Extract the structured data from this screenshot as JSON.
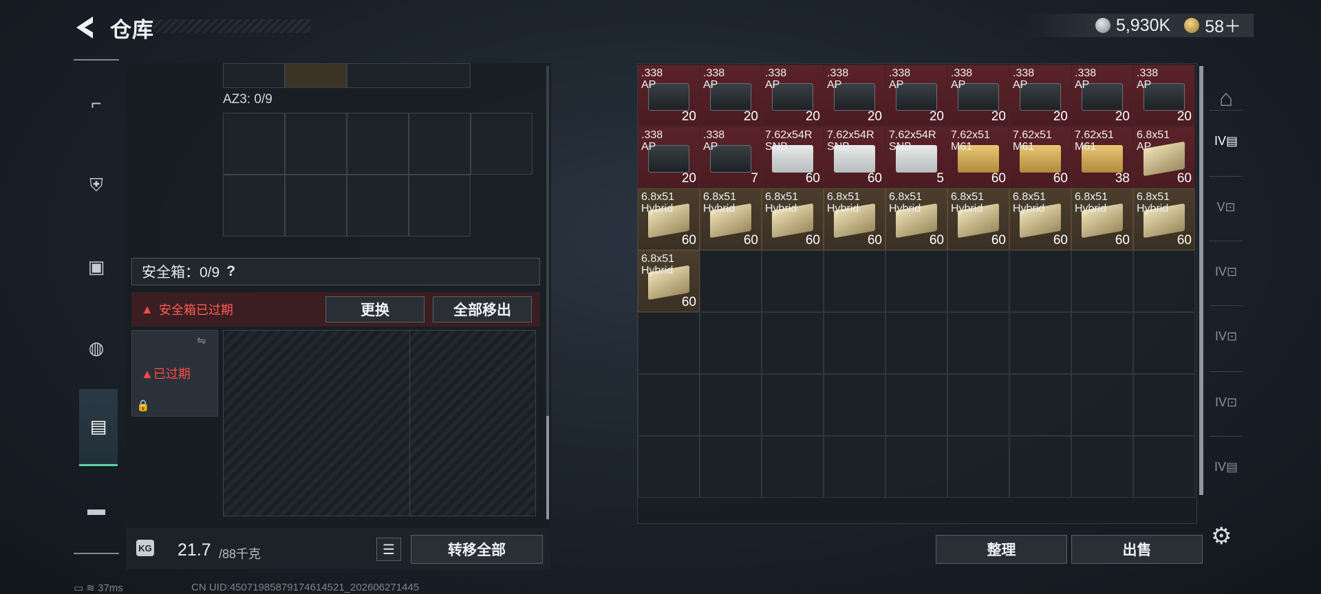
{
  "header": {
    "title": "仓库",
    "silver": "5,930K",
    "gold": "58＋"
  },
  "nav": {
    "items": [
      {
        "icon": "gun-icon",
        "glyph": "⌐"
      },
      {
        "icon": "vest-icon",
        "glyph": "⛨"
      },
      {
        "icon": "armor-icon",
        "glyph": "▣"
      },
      {
        "icon": "backpack-icon",
        "glyph": "◍"
      },
      {
        "icon": "safe-box-icon",
        "glyph": "▤"
      },
      {
        "icon": "briefcase-icon",
        "glyph": "▬"
      }
    ]
  },
  "left": {
    "az_label": "AZ3: 0/9",
    "safe_title": "安全箱：0/9",
    "help_mark": "?",
    "expired_text": "安全箱已过期",
    "replace_button": "更换",
    "remove_all_button": "全部移出",
    "item_expired": "已过期",
    "weight_current": "21.7",
    "weight_max": "/88千克",
    "kg_label": "KG",
    "transfer_all_button": "转移全部"
  },
  "storage": {
    "sort_button": "整理",
    "sell_button": "出售",
    "items": [
      {
        "name": ".338\nAP",
        "count": "20",
        "style": "red",
        "box": "black"
      },
      {
        "name": ".338\nAP",
        "count": "20",
        "style": "red",
        "box": "black"
      },
      {
        "name": ".338\nAP",
        "count": "20",
        "style": "red",
        "box": "black"
      },
      {
        "name": ".338\nAP",
        "count": "20",
        "style": "red",
        "box": "black"
      },
      {
        "name": ".338\nAP",
        "count": "20",
        "style": "red",
        "box": "black"
      },
      {
        "name": ".338\nAP",
        "count": "20",
        "style": "red",
        "box": "black"
      },
      {
        "name": ".338\nAP",
        "count": "20",
        "style": "red",
        "box": "black"
      },
      {
        "name": ".338\nAP",
        "count": "20",
        "style": "red",
        "box": "black"
      },
      {
        "name": ".338\nAP",
        "count": "20",
        "style": "red",
        "box": "black"
      },
      {
        "name": ".338\nAP",
        "count": "20",
        "style": "red",
        "box": "black"
      },
      {
        "name": ".338\nAP",
        "count": "7",
        "style": "red",
        "box": "black"
      },
      {
        "name": "7.62x54R\nSNB",
        "count": "60",
        "style": "red",
        "box": "white"
      },
      {
        "name": "7.62x54R\nSNB",
        "count": "60",
        "style": "red",
        "box": "white"
      },
      {
        "name": "7.62x54R\nSNB",
        "count": "5",
        "style": "red",
        "box": "white"
      },
      {
        "name": "7.62x51\nM61",
        "count": "60",
        "style": "red",
        "box": "gold"
      },
      {
        "name": "7.62x51\nM61",
        "count": "60",
        "style": "red",
        "box": "gold"
      },
      {
        "name": "7.62x51\nM61",
        "count": "38",
        "style": "red",
        "box": "gold"
      },
      {
        "name": "6.8x51\nAP",
        "count": "60",
        "style": "red",
        "box": "tan"
      },
      {
        "name": "6.8x51\nHybrid",
        "count": "60",
        "style": "tan",
        "box": "tan"
      },
      {
        "name": "6.8x51\nHybrid",
        "count": "60",
        "style": "tan",
        "box": "tan"
      },
      {
        "name": "6.8x51\nHybrid",
        "count": "60",
        "style": "tan",
        "box": "tan"
      },
      {
        "name": "6.8x51\nHybrid",
        "count": "60",
        "style": "tan",
        "box": "tan"
      },
      {
        "name": "6.8x51\nHybrid",
        "count": "60",
        "style": "tan",
        "box": "tan"
      },
      {
        "name": "6.8x51\nHybrid",
        "count": "60",
        "style": "tan",
        "box": "tan"
      },
      {
        "name": "6.8x51\nHybrid",
        "count": "60",
        "style": "tan",
        "box": "tan"
      },
      {
        "name": "6.8x51\nHybrid",
        "count": "60",
        "style": "tan",
        "box": "tan"
      },
      {
        "name": "6.8x51\nHybrid",
        "count": "60",
        "style": "tan",
        "box": "tan"
      },
      {
        "name": "6.8x51\nHybrid",
        "count": "60",
        "style": "tan",
        "box": "tan"
      }
    ]
  },
  "side_tabs": [
    {
      "icon": "home-shelf-icon",
      "glyph": "⌂"
    },
    {
      "icon": "storage-tab-icon",
      "glyph": "IV▤"
    },
    {
      "icon": "storage-tab-icon",
      "glyph": "V⊡"
    },
    {
      "icon": "storage-tab-icon",
      "glyph": "IV⊡"
    },
    {
      "icon": "storage-tab-icon",
      "glyph": "IV⊡"
    },
    {
      "icon": "storage-tab-icon",
      "glyph": "IV⊡"
    },
    {
      "icon": "storage-tab-icon",
      "glyph": "IV▤"
    }
  ],
  "status": {
    "ping": "37ms",
    "uid": "CN UID:450719858791746145​21_202606271445"
  }
}
